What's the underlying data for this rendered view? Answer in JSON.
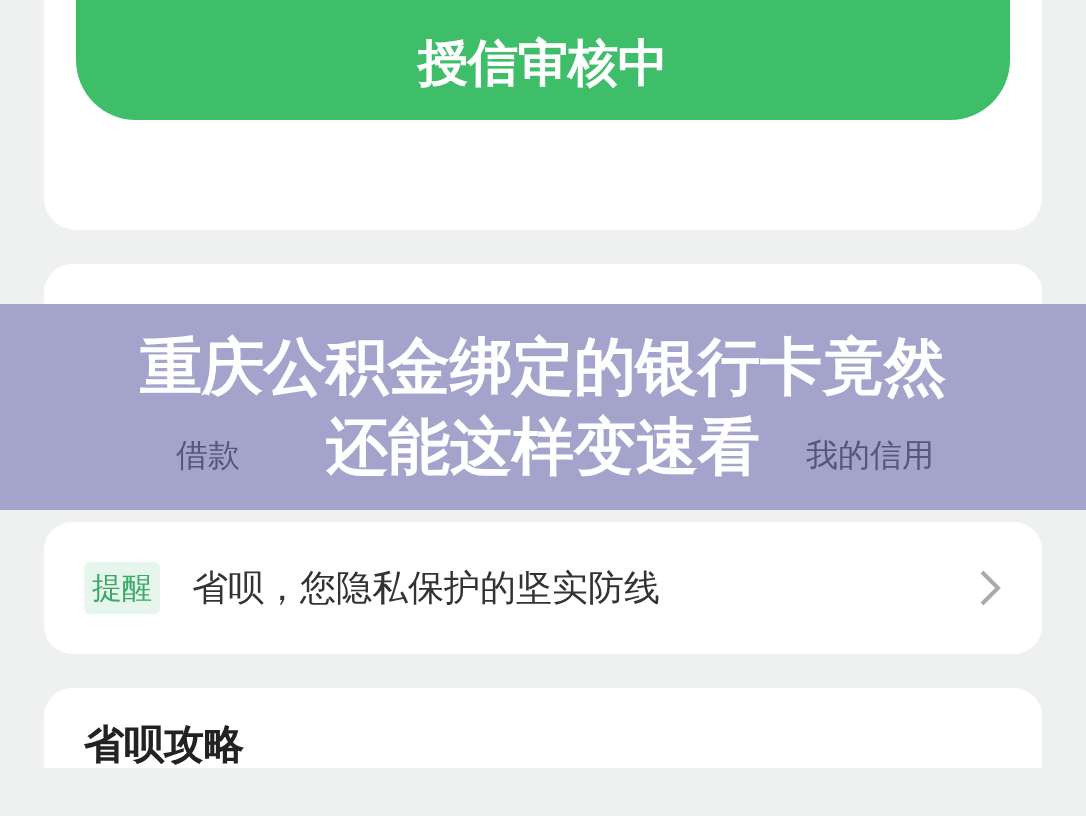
{
  "status_card": {
    "button": "授信审核中"
  },
  "shortcuts": [
    {
      "label": "借款"
    },
    {
      "label": "我的信用"
    }
  ],
  "notice": {
    "tag": "提醒",
    "text": "省呗，您隐私保护的坚实防线"
  },
  "guide": {
    "title": "省呗攻略"
  },
  "banner": {
    "lines": [
      "重庆公积金绑定的银行卡竟然",
      "还能这样变速看"
    ]
  }
}
